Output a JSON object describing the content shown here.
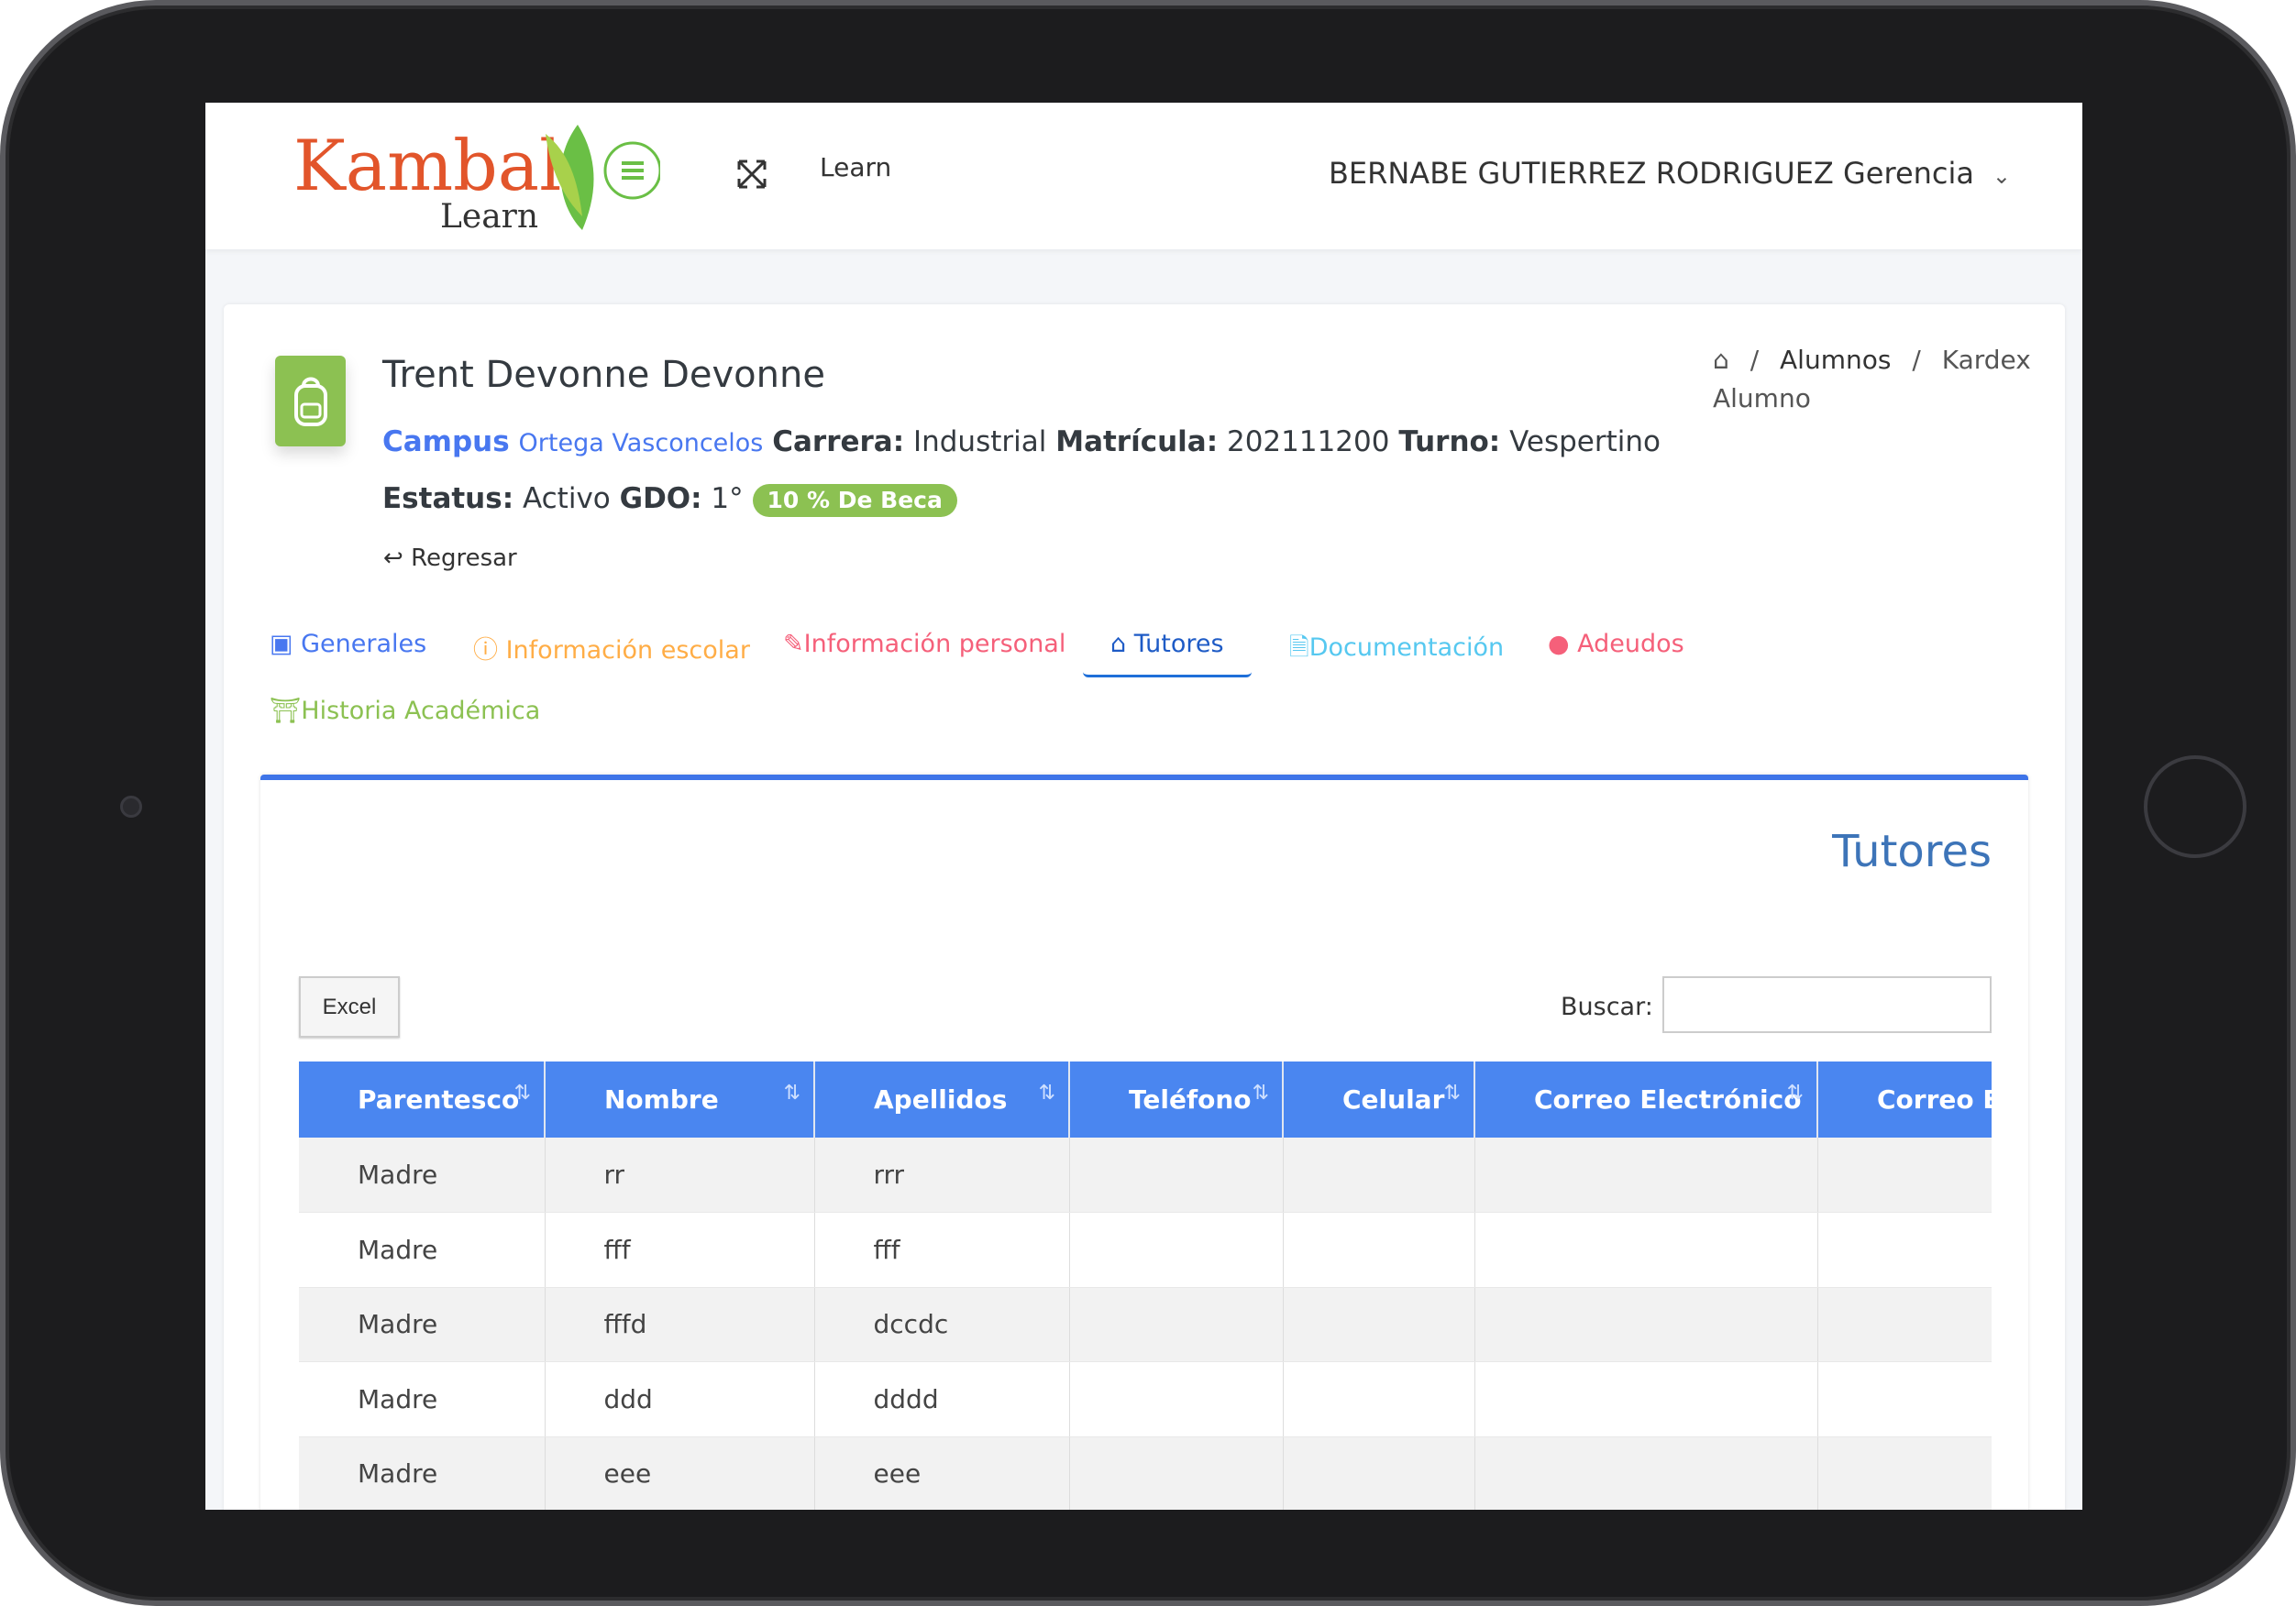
{
  "header": {
    "logo_main": "Kambal",
    "logo_sub": "Learn",
    "nav_link": "Learn",
    "user": "BERNABE GUTIERREZ RODRIGUEZ Gerencia"
  },
  "student": {
    "name": "Trent Devonne Devonne",
    "campus_label": "Campus",
    "campus_value": "Ortega Vasconcelos",
    "carrera_label": "Carrera:",
    "carrera_value": "Industrial",
    "matricula_label": "Matrícula:",
    "matricula_value": "202111200",
    "turno_label": "Turno:",
    "turno_value": "Vespertino",
    "estatus_label": "Estatus:",
    "estatus_value": "Activo",
    "gdo_label": "GDO:",
    "gdo_value": "1°",
    "beca_badge": "10 % De Beca",
    "back": "Regresar"
  },
  "breadcrumb": {
    "sep": "/",
    "items": [
      "Alumnos",
      "Kardex Alumno"
    ]
  },
  "tabs": [
    {
      "label": "Generales",
      "icon": "id-badge-icon",
      "color": "#4877f0"
    },
    {
      "label": "Información escolar",
      "icon": "info-circle-icon",
      "color": "#ffad46"
    },
    {
      "label": "Información personal",
      "icon": "pencil-icon",
      "color": "#f5607a"
    },
    {
      "label": "Tutores",
      "icon": "home-icon",
      "color": "#1e5bc6",
      "active": true
    },
    {
      "label": "Documentación",
      "icon": "file-word-icon",
      "color": "#56c8f0"
    },
    {
      "label": "Adeudos",
      "icon": "comments-dollar-icon",
      "color": "#f5607a"
    },
    {
      "label": "Historia Académica",
      "icon": "university-icon",
      "color": "#8cc152"
    }
  ],
  "panel": {
    "title": "Tutores",
    "excel": "Excel",
    "search_label": "Buscar:",
    "search_value": ""
  },
  "table": {
    "columns": [
      "Parentesco",
      "Nombre",
      "Apellidos",
      "Teléfono",
      "Celular",
      "Correo Electrónico",
      "Correo Electrónico"
    ],
    "rows": [
      [
        "Madre",
        "rr",
        "rrr",
        "",
        "",
        "",
        ""
      ],
      [
        "Madre",
        "fff",
        "fff",
        "",
        "",
        "",
        ""
      ],
      [
        "Madre",
        "fffd",
        "dccdc",
        "",
        "",
        "",
        ""
      ],
      [
        "Madre",
        "ddd",
        "dddd",
        "",
        "",
        "",
        ""
      ],
      [
        "Madre",
        "eee",
        "eee",
        "",
        "",
        "",
        ""
      ]
    ]
  }
}
